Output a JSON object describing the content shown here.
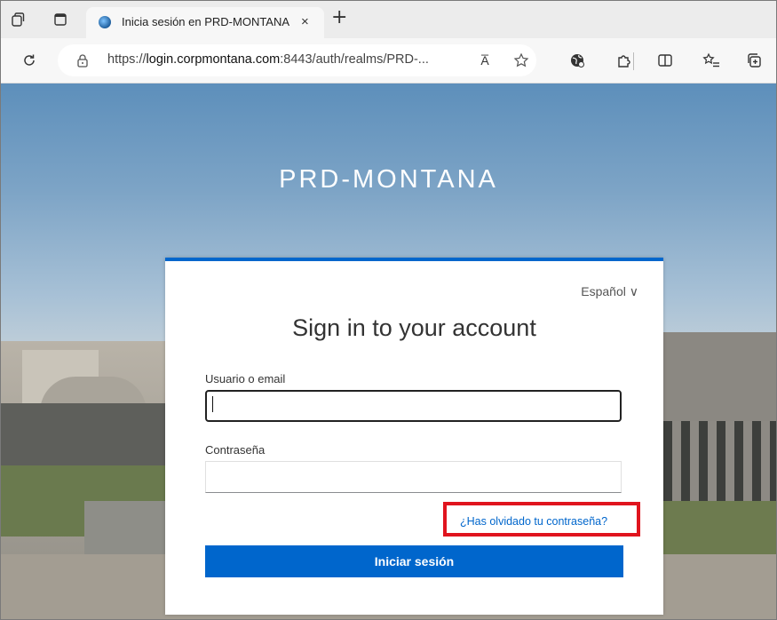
{
  "browser": {
    "tab": {
      "title": "Inicia sesión en PRD-MONTANA",
      "close_label": "×"
    },
    "new_tab_label": "+",
    "address": {
      "url_prefix": "https://",
      "url_host": "login.corpmontana.com",
      "url_rest": ":8443/auth/realms/PRD-...",
      "read_aloud_label": "A̅"
    }
  },
  "page": {
    "realm_title": "PRD-MONTANA",
    "language": "Español ∨",
    "heading": "Sign in to your account",
    "username_label": "Usuario o email",
    "username_value": "",
    "password_label": "Contraseña",
    "password_value": "",
    "forgot_password_link": "¿Has olvidado tu contraseña?",
    "submit_label": "Iniciar sesión"
  },
  "colors": {
    "accent": "#0066cc",
    "highlight": "#e0141e"
  }
}
